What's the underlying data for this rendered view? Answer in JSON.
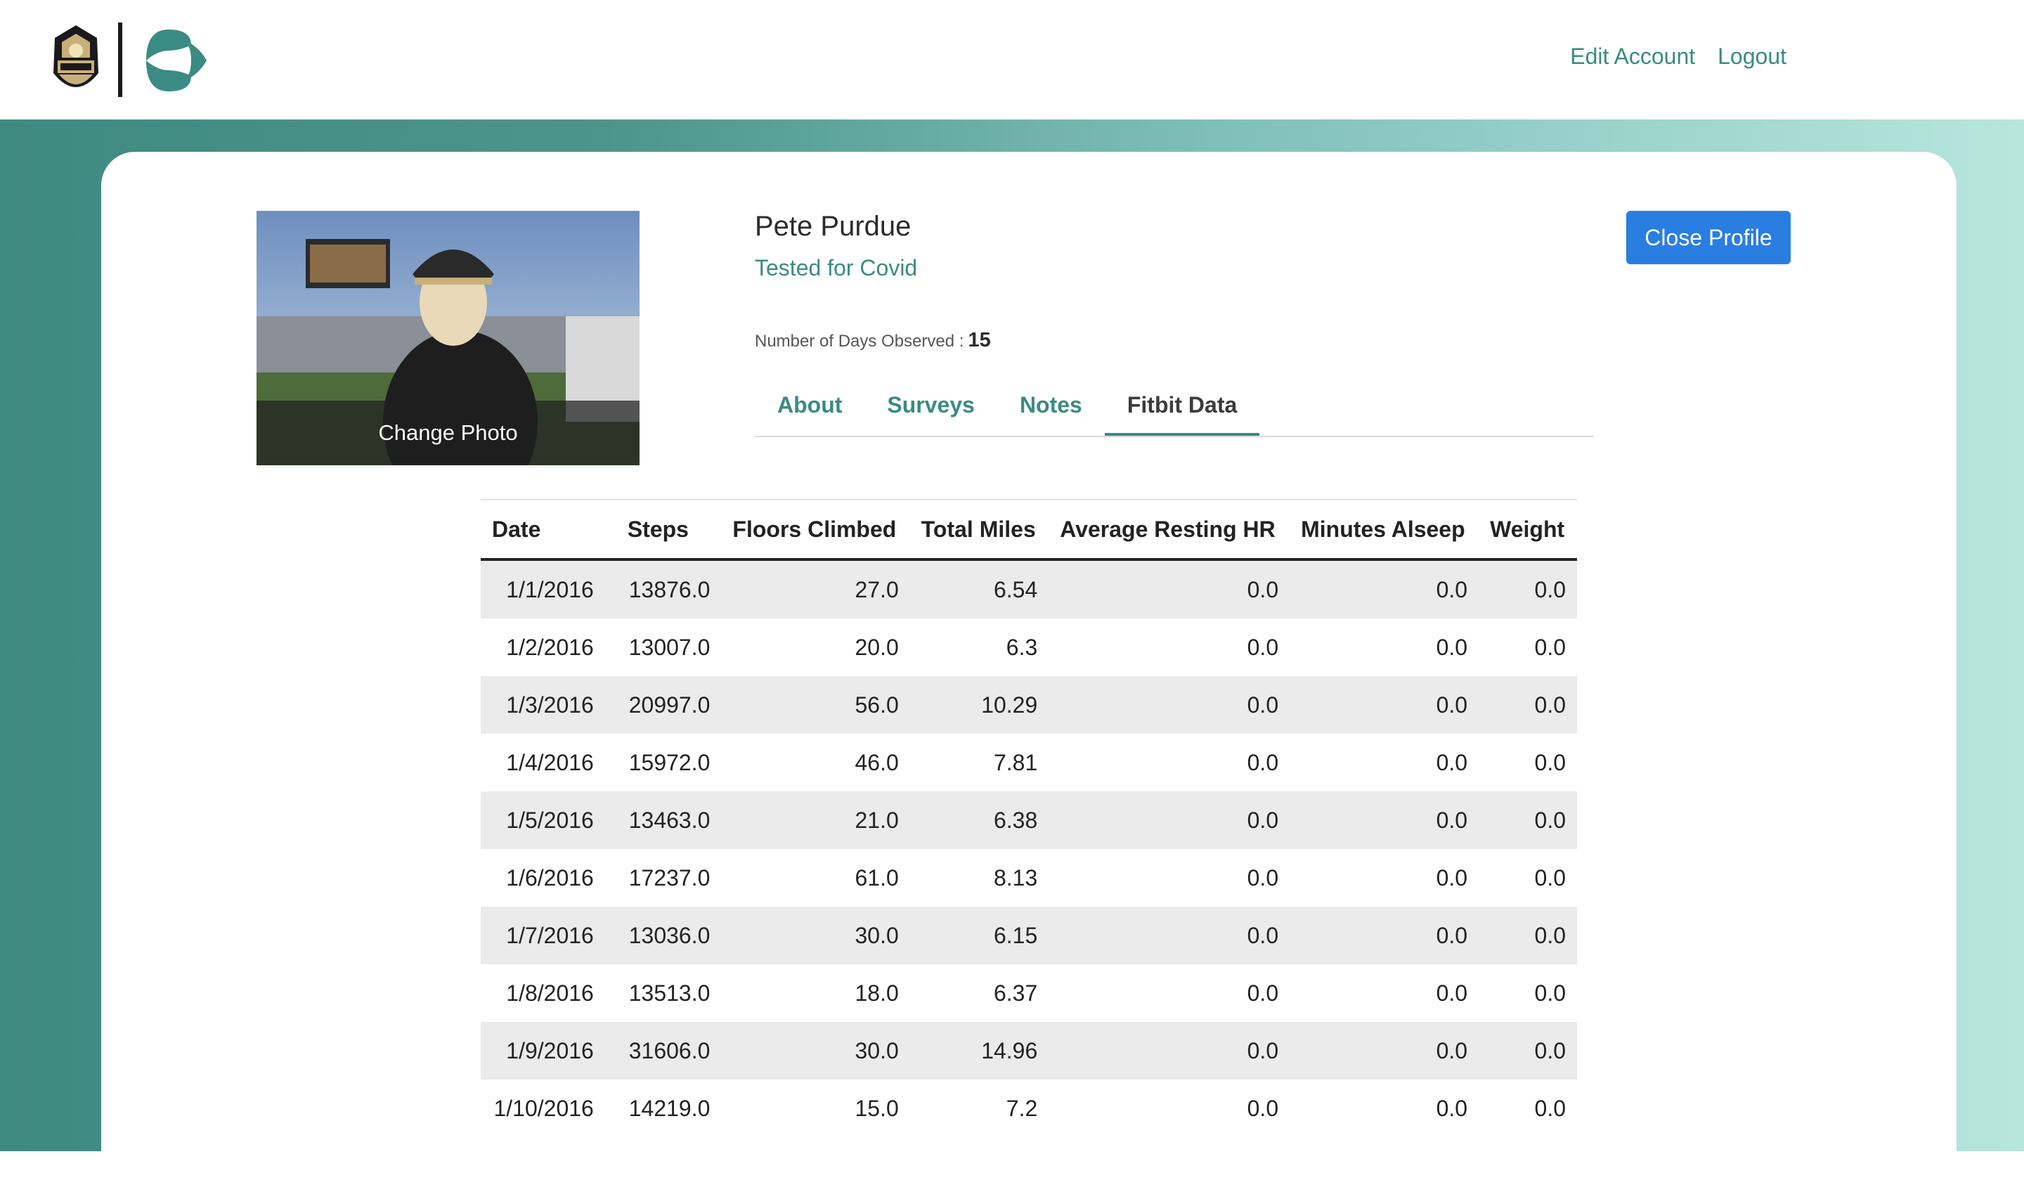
{
  "header": {
    "nav": [
      {
        "label": "Edit Account"
      },
      {
        "label": "Logout"
      }
    ]
  },
  "profile": {
    "name": "Pete Purdue",
    "status": "Tested for Covid",
    "days_label": "Number of Days Observed :",
    "days_value": "15",
    "change_photo": "Change Photo",
    "close_button": "Close Profile"
  },
  "tabs": [
    {
      "label": "About",
      "active": false
    },
    {
      "label": "Surveys",
      "active": false
    },
    {
      "label": "Notes",
      "active": false
    },
    {
      "label": "Fitbit Data",
      "active": true
    }
  ],
  "table": {
    "columns": [
      "Date",
      "Steps",
      "Floors Climbed",
      "Total Miles",
      "Average Resting HR",
      "Minutes Alseep",
      "Weight"
    ],
    "rows": [
      [
        "1/1/2016",
        "13876.0",
        "27.0",
        "6.54",
        "0.0",
        "0.0",
        "0.0"
      ],
      [
        "1/2/2016",
        "13007.0",
        "20.0",
        "6.3",
        "0.0",
        "0.0",
        "0.0"
      ],
      [
        "1/3/2016",
        "20997.0",
        "56.0",
        "10.29",
        "0.0",
        "0.0",
        "0.0"
      ],
      [
        "1/4/2016",
        "15972.0",
        "46.0",
        "7.81",
        "0.0",
        "0.0",
        "0.0"
      ],
      [
        "1/5/2016",
        "13463.0",
        "21.0",
        "6.38",
        "0.0",
        "0.0",
        "0.0"
      ],
      [
        "1/6/2016",
        "17237.0",
        "61.0",
        "8.13",
        "0.0",
        "0.0",
        "0.0"
      ],
      [
        "1/7/2016",
        "13036.0",
        "30.0",
        "6.15",
        "0.0",
        "0.0",
        "0.0"
      ],
      [
        "1/8/2016",
        "13513.0",
        "18.0",
        "6.37",
        "0.0",
        "0.0",
        "0.0"
      ],
      [
        "1/9/2016",
        "31606.0",
        "30.0",
        "14.96",
        "0.0",
        "0.0",
        "0.0"
      ],
      [
        "1/10/2016",
        "14219.0",
        "15.0",
        "7.2",
        "0.0",
        "0.0",
        "0.0"
      ]
    ]
  },
  "colors": {
    "accent": "#3a8b83",
    "button": "#2a7de1",
    "band_start": "#3f8a80",
    "band_end": "#b8e6df"
  },
  "icons": {
    "left_logo": "purdue-pete-logo-icon",
    "right_logo": "interlocking-circles-logo-icon"
  }
}
